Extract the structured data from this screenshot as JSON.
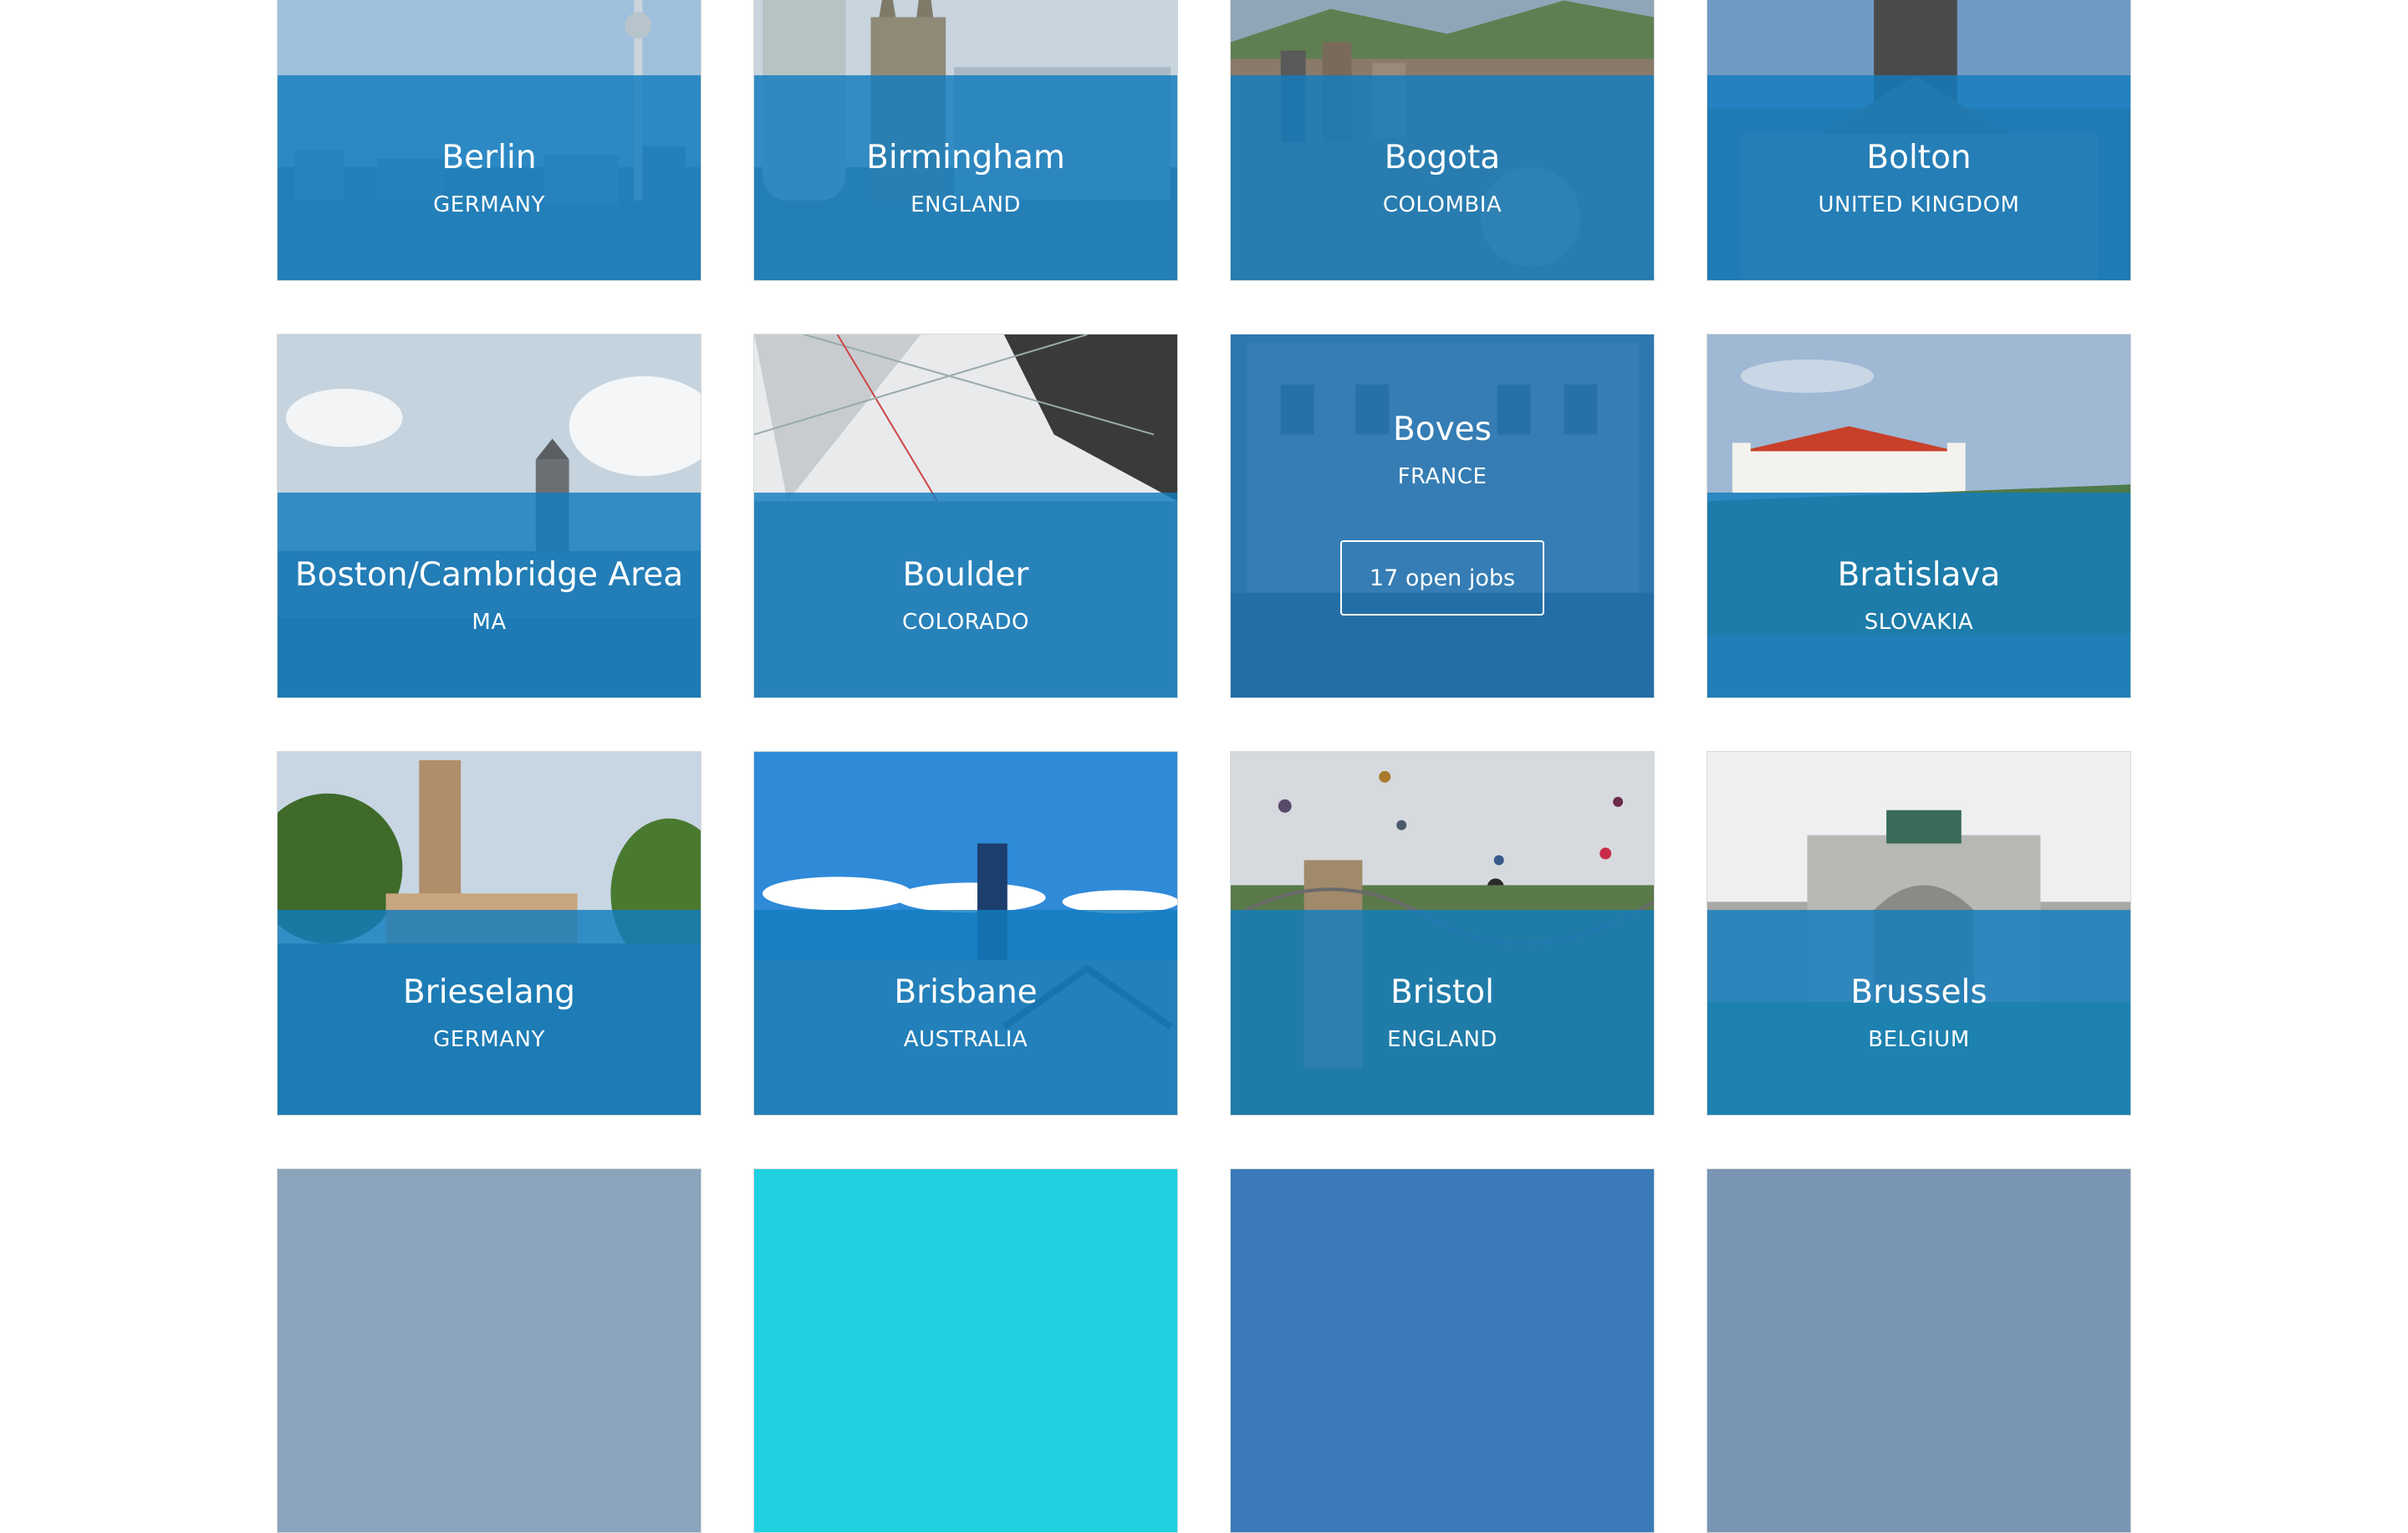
{
  "locations": [
    {
      "city": "Berlin",
      "country": "GERMANY",
      "scene": "tv-tower-icon"
    },
    {
      "city": "Birmingham",
      "country": "ENGLAND",
      "scene": "cathedral-icon"
    },
    {
      "city": "Bogota",
      "country": "COLOMBIA",
      "scene": "hillside-city-icon"
    },
    {
      "city": "Bolton",
      "country": "UNITED KINGDOM",
      "scene": "town-hall-icon"
    },
    {
      "city": "Boston/Cambridge Area",
      "country": "MA",
      "scene": "bridge-skyline-icon"
    },
    {
      "city": "Boulder",
      "country": "COLORADO",
      "scene": "atrium-ceiling-icon"
    },
    {
      "city": "Boves",
      "country": "FRANCE",
      "scene": "building-facade-icon",
      "jobs": "17 open jobs"
    },
    {
      "city": "Bratislava",
      "country": "SLOVAKIA",
      "scene": "castle-icon"
    },
    {
      "city": "Brieselang",
      "country": "GERMANY",
      "scene": "church-tower-icon"
    },
    {
      "city": "Brisbane",
      "country": "AUSTRALIA",
      "scene": "skyscraper-bridge-icon"
    },
    {
      "city": "Bristol",
      "country": "ENGLAND",
      "scene": "balloons-suspension-bridge-icon"
    },
    {
      "city": "Brussels",
      "country": "BELGIUM",
      "scene": "triumphal-arch-icon"
    }
  ],
  "colors": {
    "overlay": "#127dbe",
    "text": "#ffffff"
  }
}
